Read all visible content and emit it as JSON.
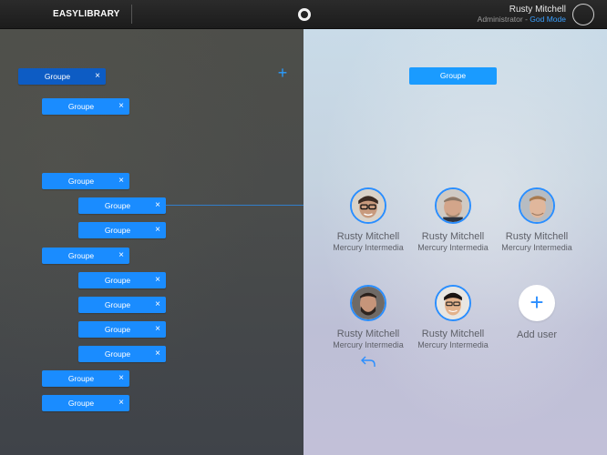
{
  "header": {
    "brand": "EASYLIBRARY",
    "user_name": "Rusty Mitchell",
    "user_role": "Administrator",
    "role_separator": " - ",
    "user_mode": "God Mode"
  },
  "tree": {
    "items": [
      {
        "label": "Groupe",
        "close": "×"
      },
      {
        "label": "Groupe",
        "close": "×"
      },
      {
        "label": "Groupe",
        "close": "×"
      },
      {
        "label": "Groupe",
        "close": "×"
      },
      {
        "label": "Groupe",
        "close": "×"
      },
      {
        "label": "Groupe",
        "close": "×"
      },
      {
        "label": "Groupe",
        "close": "×"
      },
      {
        "label": "Groupe",
        "close": "×"
      },
      {
        "label": "Groupe",
        "close": "×"
      },
      {
        "label": "Groupe",
        "close": "×"
      },
      {
        "label": "Groupe",
        "close": "×"
      },
      {
        "label": "Groupe",
        "close": "×"
      }
    ],
    "add_symbol": "+"
  },
  "detail": {
    "group_title": "Groupe",
    "users": [
      {
        "name": "Rusty Mitchell",
        "company": "Mercury Intermedia"
      },
      {
        "name": "Rusty Mitchell",
        "company": "Mercury Intermedia"
      },
      {
        "name": "Rusty Mitchell",
        "company": "Mercury Intermedia"
      },
      {
        "name": "Rusty Mitchell",
        "company": "Mercury Intermedia"
      },
      {
        "name": "Rusty Mitchell",
        "company": "Mercury Intermedia"
      }
    ],
    "add_user_symbol": "+",
    "add_user_label": "Add user"
  },
  "colors": {
    "accent": "#1a8cff",
    "accent_dark": "#0d5cc4",
    "mode_link": "#3aa0ff"
  }
}
